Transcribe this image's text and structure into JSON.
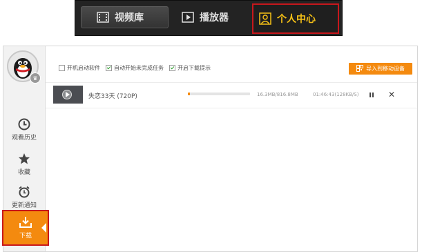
{
  "topbar": {
    "tabs": [
      {
        "label": "视频库",
        "icon": "film-icon",
        "active": false
      },
      {
        "label": "播放器",
        "icon": "play-icon",
        "active": false
      },
      {
        "label": "个人中心",
        "icon": "user-icon",
        "active": true
      }
    ],
    "highlight_color": "#c8171c",
    "active_text_color": "#f5c016"
  },
  "sidebar": {
    "avatar_icon": "qq-penguin-avatar",
    "avatar_badge": "crown-icon",
    "items": [
      {
        "label": "观看历史",
        "icon": "clock-icon"
      },
      {
        "label": "收藏",
        "icon": "star-icon"
      },
      {
        "label": "更新通知",
        "icon": "alarm-icon"
      },
      {
        "label": "下载",
        "icon": "download-icon",
        "active": true
      }
    ],
    "accent_color": "#f48a0f"
  },
  "options": {
    "boot_start": {
      "label": "开机启动软件",
      "checked": false
    },
    "auto_resume": {
      "label": "自动开始未完成任务",
      "checked": true
    },
    "download_hint": {
      "label": "开启下载提示",
      "checked": true
    },
    "import_button": "导入到移动设备",
    "import_icon": "qr-code-icon"
  },
  "downloads": [
    {
      "title": "失恋33天 (720P)",
      "progress": 0.03,
      "size": "16.3MB/816.8MB",
      "eta": "01:46:43(128KB/S)",
      "pause_icon": "pause-icon",
      "cancel_icon": "close-icon",
      "cancel_glyph": "✕"
    }
  ]
}
